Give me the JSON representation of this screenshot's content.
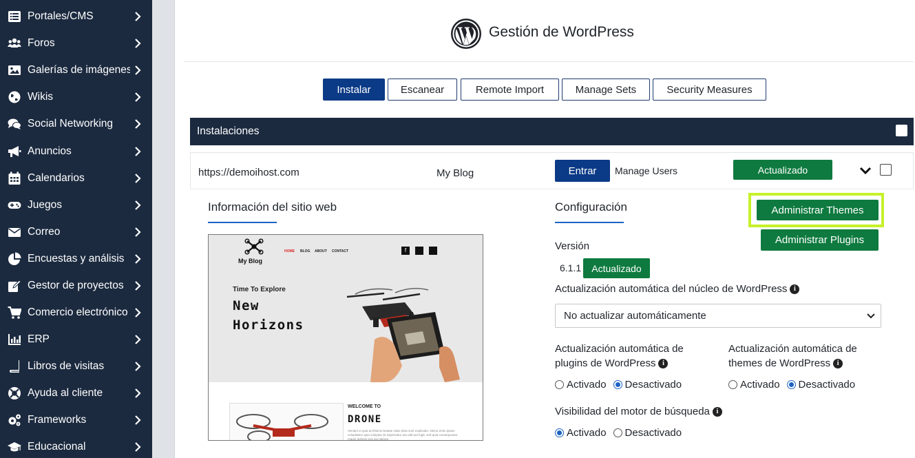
{
  "sidebar": {
    "items": [
      {
        "label": "Portales/CMS",
        "icon": "list-icon"
      },
      {
        "label": "Foros",
        "icon": "users-icon"
      },
      {
        "label": "Galerías de imágenes",
        "icon": "image-icon"
      },
      {
        "label": "Wikis",
        "icon": "globe-icon"
      },
      {
        "label": "Social Networking",
        "icon": "comments-icon"
      },
      {
        "label": "Anuncios",
        "icon": "megaphone-icon"
      },
      {
        "label": "Calendarios",
        "icon": "calendar-icon"
      },
      {
        "label": "Juegos",
        "icon": "gamepad-icon"
      },
      {
        "label": "Correo",
        "icon": "envelope-icon"
      },
      {
        "label": "Encuestas y análisis",
        "icon": "pie-chart-icon"
      },
      {
        "label": "Gestor de proyectos",
        "icon": "edit-icon"
      },
      {
        "label": "Comercio electrónico",
        "icon": "cart-icon"
      },
      {
        "label": "ERP",
        "icon": "bar-chart-icon"
      },
      {
        "label": "Libros de visitas",
        "icon": "book-icon"
      },
      {
        "label": "Ayuda al cliente",
        "icon": "lifering-icon"
      },
      {
        "label": "Frameworks",
        "icon": "cogs-icon"
      },
      {
        "label": "Educacional",
        "icon": "graduation-cap-icon"
      }
    ]
  },
  "header": {
    "title": "Gestión de WordPress"
  },
  "tabs": [
    {
      "label": "Instalar",
      "active": true
    },
    {
      "label": "Escanear",
      "active": false
    },
    {
      "label": "Remote Import",
      "active": false
    },
    {
      "label": "Manage Sets",
      "active": false
    },
    {
      "label": "Security Measures",
      "active": false
    }
  ],
  "installations": {
    "title": "Instalaciones",
    "row": {
      "url": "https://demoihost.com",
      "name": "My Blog",
      "enter_label": "Entrar",
      "manage_users_label": "Manage Users",
      "status_label": "Actualizado"
    }
  },
  "site_info": {
    "title": "Información del sitio web",
    "preview": {
      "logo_text": "My Blog",
      "nav": [
        "HOME",
        "BLOG",
        "ABOUT",
        "CONTACT"
      ],
      "tagline": "Time To Explore",
      "headline_1": "New",
      "headline_2": "Horizons",
      "welcome": "WELCOME TO",
      "drone": "DRONE",
      "body_text": "Veniam ei quia architecto beatae vitae dicta sunt explicabo. Nemo enim ipsam voluptatem quia voluptas sit aspernatur aut odit aut fugit, sed quia consequuntur magni dolores eos qui ratione."
    }
  },
  "config": {
    "title": "Configuración",
    "themes_button": "Administrar Themes",
    "plugins_button": "Administrar Plugins",
    "version_label": "Versión",
    "version_value": "6.1.1",
    "version_status": "Actualizado",
    "core_update_label": "Actualización automática del núcleo de WordPress",
    "core_update_value": "No actualizar automáticamente",
    "plugins_update_label_1": "Actualización automática de",
    "plugins_update_label_2": "plugins de WordPress",
    "themes_update_label_1": "Actualización automática de",
    "themes_update_label_2": "themes de WordPress",
    "option_on": "Activado",
    "option_off": "Desactivado",
    "search_visibility_label": "Visibilidad del motor de búsqueda"
  },
  "colors": {
    "sidebar_bg": "#1b2a3f",
    "primary_blue": "#0b3a86",
    "success_green": "#0e7a3f",
    "highlight": "#c6f12a",
    "link_blue": "#1a62c5"
  }
}
